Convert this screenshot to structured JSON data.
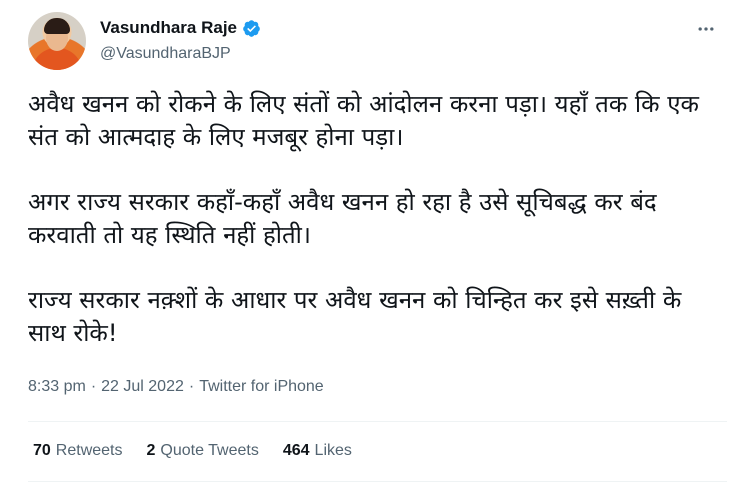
{
  "author": {
    "display_name": "Vasundhara Raje",
    "handle": "@VasundharaBJP",
    "verified": true
  },
  "tweet": {
    "paragraphs": [
      "अवैध खनन को रोकने के लिए संतों को आंदोलन करना पड़ा। यहाँ तक कि एक संत को आत्मदाह के लिए मजबूर होना पड़ा।",
      "अगर राज्य सरकार कहाँ-कहाँ अवैध खनन हो रहा है उसे सूचिबद्ध कर बंद करवाती तो यह स्थिति नहीं होती।",
      "राज्य सरकार नक़्शों के आधार पर अवैध खनन को चिन्हित कर इसे सख़्ती के साथ रोके!"
    ],
    "time": "8:33 pm",
    "separator": "·",
    "date": "22 Jul 2022",
    "source": "Twitter for iPhone"
  },
  "stats": {
    "retweets_count": "70",
    "retweets_label": "Retweets",
    "quotes_count": "2",
    "quotes_label": "Quote Tweets",
    "likes_count": "464",
    "likes_label": "Likes"
  },
  "colors": {
    "text_primary": "#0f1419",
    "text_secondary": "#536471",
    "verified_blue": "#1d9bf0",
    "divider": "#eff3f4"
  },
  "icons": {
    "verified": "verified-badge-icon",
    "more": "more-options-icon"
  }
}
